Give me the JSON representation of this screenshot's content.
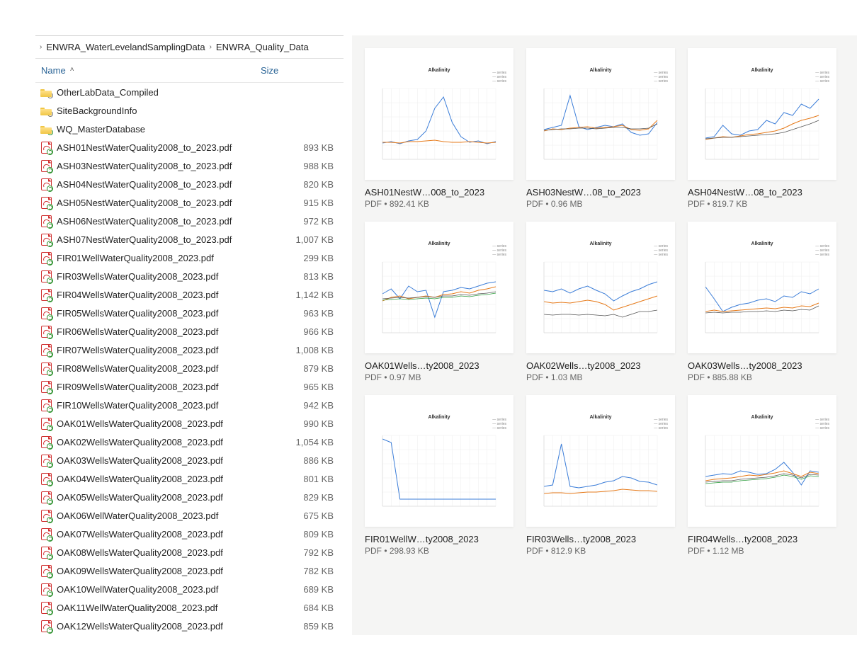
{
  "breadcrumb": {
    "parent": "ENWRA_WaterLevelandSamplingData",
    "current": "ENWRA_Quality_Data"
  },
  "columns": {
    "name": "Name",
    "size": "Size"
  },
  "sort": {
    "column": "name",
    "direction": "asc"
  },
  "folders": [
    {
      "name": "OtherLabData_Compiled",
      "badge": "lock"
    },
    {
      "name": "SiteBackgroundInfo",
      "badge": "lock"
    },
    {
      "name": "WQ_MasterDatabase",
      "badge": "sync"
    }
  ],
  "files": [
    {
      "name": "ASH01NestWaterQuality2008_to_2023.pdf",
      "size": "893 KB"
    },
    {
      "name": "ASH03NestWaterQuality2008_to_2023.pdf",
      "size": "988 KB"
    },
    {
      "name": "ASH04NestWaterQuality2008_to_2023.pdf",
      "size": "820 KB"
    },
    {
      "name": "ASH05NestWaterQuality2008_to_2023.pdf",
      "size": "915 KB"
    },
    {
      "name": "ASH06NestWaterQuality2008_to_2023.pdf",
      "size": "972 KB"
    },
    {
      "name": "ASH07NestWaterQuality2008_to_2023.pdf",
      "size": "1,007 KB"
    },
    {
      "name": "FIR01WellWaterQuality2008_2023.pdf",
      "size": "299 KB"
    },
    {
      "name": "FIR03WellsWaterQuality2008_2023.pdf",
      "size": "813 KB"
    },
    {
      "name": "FIR04WellsWaterQuality2008_2023.pdf",
      "size": "1,142 KB"
    },
    {
      "name": "FIR05WellsWaterQuality2008_2023.pdf",
      "size": "963 KB"
    },
    {
      "name": "FIR06WellsWaterQuality2008_2023.pdf",
      "size": "966 KB"
    },
    {
      "name": "FIR07WellsWaterQuality2008_2023.pdf",
      "size": "1,008 KB"
    },
    {
      "name": "FIR08WellsWaterQuality2008_2023.pdf",
      "size": "879 KB"
    },
    {
      "name": "FIR09WellsWaterQuality2008_2023.pdf",
      "size": "965 KB"
    },
    {
      "name": "FIR10WellsWaterQuality2008_2023.pdf",
      "size": "942 KB"
    },
    {
      "name": "OAK01WellsWaterQuality2008_2023.pdf",
      "size": "990 KB"
    },
    {
      "name": "OAK02WellsWaterQuality2008_2023.pdf",
      "size": "1,054 KB"
    },
    {
      "name": "OAK03WellsWaterQuality2008_2023.pdf",
      "size": "886 KB"
    },
    {
      "name": "OAK04WellsWaterQuality2008_2023.pdf",
      "size": "801 KB"
    },
    {
      "name": "OAK05WellsWaterQuality2008_2023.pdf",
      "size": "829 KB"
    },
    {
      "name": "OAK06WellWaterQuality2008_2023.pdf",
      "size": "675 KB"
    },
    {
      "name": "OAK07WellsWaterQuality2008_2023.pdf",
      "size": "809 KB"
    },
    {
      "name": "OAK08WellsWaterQuality2008_2023.pdf",
      "size": "792 KB"
    },
    {
      "name": "OAK09WellsWaterQuality2008_2023.pdf",
      "size": "782 KB"
    },
    {
      "name": "OAK10WellWaterQuality2008_2023.pdf",
      "size": "689 KB"
    },
    {
      "name": "OAK11WellWaterQuality2008_2023.pdf",
      "size": "684 KB"
    },
    {
      "name": "OAK12WellsWaterQuality2008_2023.pdf",
      "size": "859 KB"
    }
  ],
  "thumbs": [
    {
      "title": "ASH01NestW…008_to_2023",
      "meta": "PDF • 892.41 KB",
      "chart": "Alkalinity",
      "series": [
        [
          23,
          25,
          22,
          26,
          28,
          40,
          72,
          88,
          52,
          32,
          24,
          26,
          22,
          25
        ],
        [
          24,
          24,
          23,
          25,
          25,
          26,
          27,
          25,
          24,
          24,
          25,
          24,
          23,
          24
        ]
      ]
    },
    {
      "title": "ASH03NestW…08_to_2023",
      "meta": "PDF • 0.96 MB",
      "chart": "Alkalinity",
      "series": [
        [
          42,
          45,
          48,
          90,
          46,
          42,
          45,
          48,
          46,
          50,
          38,
          34,
          36,
          52
        ],
        [
          40,
          43,
          42,
          44,
          45,
          46,
          44,
          45,
          46,
          48,
          42,
          41,
          43,
          55
        ],
        [
          41,
          42,
          43,
          43,
          44,
          44,
          43,
          44,
          45,
          45,
          43,
          43,
          44,
          50
        ]
      ]
    },
    {
      "title": "ASH04NestW…08_to_2023",
      "meta": "PDF • 819.7 KB",
      "chart": "Alkalinity",
      "series": [
        [
          30,
          32,
          48,
          36,
          34,
          40,
          42,
          55,
          50,
          66,
          62,
          78,
          72,
          85
        ],
        [
          28,
          30,
          32,
          31,
          33,
          35,
          36,
          38,
          40,
          44,
          50,
          55,
          58,
          62
        ],
        [
          29,
          30,
          31,
          31,
          32,
          33,
          34,
          35,
          36,
          38,
          42,
          46,
          50,
          55
        ]
      ]
    },
    {
      "title": "OAK01Wells…ty2008_2023",
      "meta": "PDF • 0.97 MB",
      "chart": "Alkalinity",
      "series": [
        [
          55,
          62,
          48,
          66,
          58,
          60,
          22,
          58,
          60,
          64,
          62,
          66,
          70,
          72
        ],
        [
          45,
          50,
          52,
          48,
          50,
          52,
          50,
          54,
          55,
          58,
          56,
          60,
          62,
          65
        ],
        [
          48,
          49,
          50,
          49,
          50,
          51,
          50,
          52,
          52,
          54,
          53,
          55,
          56,
          58
        ],
        [
          46,
          47,
          48,
          47,
          48,
          49,
          48,
          50,
          50,
          52,
          51,
          53,
          54,
          56
        ]
      ]
    },
    {
      "title": "OAK02Wells…ty2008_2023",
      "meta": "PDF • 1.03 MB",
      "chart": "Alkalinity",
      "series": [
        [
          60,
          58,
          62,
          56,
          62,
          66,
          60,
          55,
          45,
          52,
          58,
          62,
          68,
          72
        ],
        [
          44,
          42,
          43,
          42,
          44,
          46,
          44,
          40,
          32,
          36,
          40,
          44,
          48,
          52
        ],
        [
          26,
          25,
          26,
          26,
          25,
          26,
          25,
          24,
          26,
          22,
          26,
          30,
          30,
          32
        ]
      ]
    },
    {
      "title": "OAK03Wells…ty2008_2023",
      "meta": "PDF • 885.88 KB",
      "chart": "Alkalinity",
      "series": [
        [
          65,
          48,
          30,
          36,
          40,
          42,
          46,
          48,
          44,
          52,
          50,
          58,
          55,
          62
        ],
        [
          30,
          32,
          30,
          31,
          32,
          33,
          34,
          35,
          34,
          36,
          35,
          38,
          37,
          42
        ],
        [
          28,
          29,
          28,
          29,
          29,
          30,
          30,
          31,
          30,
          32,
          31,
          33,
          32,
          38
        ]
      ]
    },
    {
      "title": "FIR01WellW…ty2008_2023",
      "meta": "PDF • 298.93 KB",
      "chart": "Alkalinity",
      "series": [
        [
          95,
          90,
          10,
          10,
          10,
          10,
          10,
          10,
          10,
          10,
          10,
          10,
          10,
          10
        ]
      ]
    },
    {
      "title": "FIR03Wells…ty2008_2023",
      "meta": "PDF • 812.9 KB",
      "chart": "Alkalinity",
      "series": [
        [
          28,
          30,
          88,
          28,
          26,
          28,
          30,
          34,
          36,
          42,
          40,
          35,
          34,
          30
        ],
        [
          18,
          19,
          19,
          18,
          19,
          20,
          20,
          21,
          22,
          24,
          23,
          22,
          22,
          21
        ]
      ]
    },
    {
      "title": "FIR04Wells…ty2008_2023",
      "meta": "PDF • 1.12 MB",
      "chart": "Alkalinity",
      "series": [
        [
          42,
          44,
          46,
          45,
          50,
          48,
          45,
          46,
          52,
          62,
          48,
          30,
          50,
          48
        ],
        [
          36,
          38,
          39,
          40,
          42,
          44,
          43,
          45,
          47,
          50,
          46,
          42,
          48,
          46
        ],
        [
          34,
          35,
          36,
          36,
          38,
          39,
          40,
          41,
          43,
          46,
          44,
          40,
          45,
          44
        ],
        [
          32,
          33,
          34,
          34,
          36,
          37,
          38,
          39,
          41,
          44,
          42,
          38,
          43,
          42
        ]
      ]
    }
  ],
  "chart_data": [
    {
      "type": "line",
      "title": "Alkalinity",
      "ylim": [
        0,
        100
      ],
      "x_count": 14,
      "series": [
        {
          "name": "s1",
          "values": [
            23,
            25,
            22,
            26,
            28,
            40,
            72,
            88,
            52,
            32,
            24,
            26,
            22,
            25
          ]
        },
        {
          "name": "s2",
          "values": [
            24,
            24,
            23,
            25,
            25,
            26,
            27,
            25,
            24,
            24,
            25,
            24,
            23,
            24
          ]
        }
      ]
    },
    {
      "type": "line",
      "title": "Alkalinity",
      "ylim": [
        0,
        100
      ],
      "x_count": 14,
      "series": [
        {
          "name": "s1",
          "values": [
            42,
            45,
            48,
            90,
            46,
            42,
            45,
            48,
            46,
            50,
            38,
            34,
            36,
            52
          ]
        },
        {
          "name": "s2",
          "values": [
            40,
            43,
            42,
            44,
            45,
            46,
            44,
            45,
            46,
            48,
            42,
            41,
            43,
            55
          ]
        },
        {
          "name": "s3",
          "values": [
            41,
            42,
            43,
            43,
            44,
            44,
            43,
            44,
            45,
            45,
            43,
            43,
            44,
            50
          ]
        }
      ]
    },
    {
      "type": "line",
      "title": "Alkalinity",
      "ylim": [
        0,
        100
      ],
      "x_count": 14,
      "series": [
        {
          "name": "s1",
          "values": [
            30,
            32,
            48,
            36,
            34,
            40,
            42,
            55,
            50,
            66,
            62,
            78,
            72,
            85
          ]
        },
        {
          "name": "s2",
          "values": [
            28,
            30,
            32,
            31,
            33,
            35,
            36,
            38,
            40,
            44,
            50,
            55,
            58,
            62
          ]
        },
        {
          "name": "s3",
          "values": [
            29,
            30,
            31,
            31,
            32,
            33,
            34,
            35,
            36,
            38,
            42,
            46,
            50,
            55
          ]
        }
      ]
    },
    {
      "type": "line",
      "title": "Alkalinity",
      "ylim": [
        0,
        100
      ],
      "x_count": 14,
      "series": [
        {
          "name": "s1",
          "values": [
            55,
            62,
            48,
            66,
            58,
            60,
            22,
            58,
            60,
            64,
            62,
            66,
            70,
            72
          ]
        },
        {
          "name": "s2",
          "values": [
            45,
            50,
            52,
            48,
            50,
            52,
            50,
            54,
            55,
            58,
            56,
            60,
            62,
            65
          ]
        },
        {
          "name": "s3",
          "values": [
            48,
            49,
            50,
            49,
            50,
            51,
            50,
            52,
            52,
            54,
            53,
            55,
            56,
            58
          ]
        },
        {
          "name": "s4",
          "values": [
            46,
            47,
            48,
            47,
            48,
            49,
            48,
            50,
            50,
            52,
            51,
            53,
            54,
            56
          ]
        }
      ]
    },
    {
      "type": "line",
      "title": "Alkalinity",
      "ylim": [
        0,
        100
      ],
      "x_count": 14,
      "series": [
        {
          "name": "s1",
          "values": [
            60,
            58,
            62,
            56,
            62,
            66,
            60,
            55,
            45,
            52,
            58,
            62,
            68,
            72
          ]
        },
        {
          "name": "s2",
          "values": [
            44,
            42,
            43,
            42,
            44,
            46,
            44,
            40,
            32,
            36,
            40,
            44,
            48,
            52
          ]
        },
        {
          "name": "s3",
          "values": [
            26,
            25,
            26,
            26,
            25,
            26,
            25,
            24,
            26,
            22,
            26,
            30,
            30,
            32
          ]
        }
      ]
    },
    {
      "type": "line",
      "title": "Alkalinity",
      "ylim": [
        0,
        100
      ],
      "x_count": 14,
      "series": [
        {
          "name": "s1",
          "values": [
            65,
            48,
            30,
            36,
            40,
            42,
            46,
            48,
            44,
            52,
            50,
            58,
            55,
            62
          ]
        },
        {
          "name": "s2",
          "values": [
            30,
            32,
            30,
            31,
            32,
            33,
            34,
            35,
            34,
            36,
            35,
            38,
            37,
            42
          ]
        },
        {
          "name": "s3",
          "values": [
            28,
            29,
            28,
            29,
            29,
            30,
            30,
            31,
            30,
            32,
            31,
            33,
            32,
            38
          ]
        }
      ]
    },
    {
      "type": "line",
      "title": "Alkalinity",
      "ylim": [
        0,
        100
      ],
      "x_count": 14,
      "series": [
        {
          "name": "s1",
          "values": [
            95,
            90,
            10,
            10,
            10,
            10,
            10,
            10,
            10,
            10,
            10,
            10,
            10,
            10
          ]
        }
      ]
    },
    {
      "type": "line",
      "title": "Alkalinity",
      "ylim": [
        0,
        100
      ],
      "x_count": 14,
      "series": [
        {
          "name": "s1",
          "values": [
            28,
            30,
            88,
            28,
            26,
            28,
            30,
            34,
            36,
            42,
            40,
            35,
            34,
            30
          ]
        },
        {
          "name": "s2",
          "values": [
            18,
            19,
            19,
            18,
            19,
            20,
            20,
            21,
            22,
            24,
            23,
            22,
            22,
            21
          ]
        }
      ]
    },
    {
      "type": "line",
      "title": "Alkalinity",
      "ylim": [
        0,
        100
      ],
      "x_count": 14,
      "series": [
        {
          "name": "s1",
          "values": [
            42,
            44,
            46,
            45,
            50,
            48,
            45,
            46,
            52,
            62,
            48,
            30,
            50,
            48
          ]
        },
        {
          "name": "s2",
          "values": [
            36,
            38,
            39,
            40,
            42,
            44,
            43,
            45,
            47,
            50,
            46,
            42,
            48,
            46
          ]
        },
        {
          "name": "s3",
          "values": [
            34,
            35,
            36,
            36,
            38,
            39,
            40,
            41,
            43,
            46,
            44,
            40,
            45,
            44
          ]
        },
        {
          "name": "s4",
          "values": [
            32,
            33,
            34,
            34,
            36,
            37,
            38,
            39,
            41,
            44,
            42,
            38,
            43,
            42
          ]
        }
      ]
    }
  ]
}
